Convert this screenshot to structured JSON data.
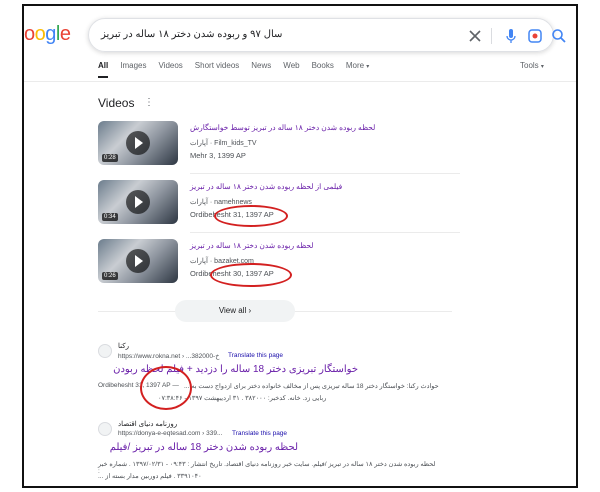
{
  "logo_text": "oogle",
  "search": {
    "query": "سال ۹۷ و ربوده شدن دختر ۱۸ ساله در تبریز"
  },
  "tabs": [
    "All",
    "Images",
    "Videos",
    "Short videos",
    "News",
    "Web",
    "Books",
    "More"
  ],
  "tools_label": "Tools",
  "videos": {
    "heading": "Videos",
    "items": [
      {
        "title": "لحظه ربوده شدن دختر ۱۸ ساله در تبریز توسط خواستگارش",
        "source": "آپارات · Film_kids_TV",
        "date": "Mehr 3, 1399 AP",
        "duration": "0:28"
      },
      {
        "title": "فیلمی از لحظه ربوده شدن دختر ۱۸ ساله در تبریز",
        "source": "آپارات · namehnews",
        "date": "Ordibehesht 31, 1397 AP",
        "duration": "0:34"
      },
      {
        "title": "لحظه ربوده شدن دختر ۱۸ ساله در تبریز",
        "source": "آپارات · bazaket.com",
        "date": "Ordibehesht 30, 1397 AP",
        "duration": "0:26"
      }
    ],
    "view_all": "View all"
  },
  "results": [
    {
      "site": "رکنا",
      "url": "https://www.rokna.net › ...ﺥ-382000",
      "translate": "Translate this page",
      "title": "خواستگار تبریزی دختر 18 ساله را دزدید + فیلم لحظه ربودن",
      "snippet1": "حوادث رکنا: خواستگار دختر 18 ساله تبریزی پس از مخالف خانواده دختر برای ازدواج دست به ...",
      "date": "Ordibehesht 31, 1397 AP —",
      "snippet2": "ربایی زد. خانه. کدخبر: ۳۸۲۰۰۰ . ۳۱ اردیبهشت ۱۳۹۷ - ۰۷:۳۸:۴۶"
    },
    {
      "site": "روزنامه دنیای اقتصاد",
      "url": "https://donya-e-eqtesad.com › 339...",
      "translate": "Translate this page",
      "title": "لحظه ربوده شدن دختر 18 ساله در تبریز /فیلم",
      "snippet1": "لحظه ربوده شدن دختر ۱۸ ساله در تبریز /فیلم. سایت خبر روزنامه دنیای اقتصاد. تاریخ انتشار : ۰۹:۴۳ - ۱۳۹۷/۰۲/۳۱ . شماره خبر :",
      "snippet2": "۳۳۹۱۰۴۰ . فیلم دوربین مدار بسته از ..."
    }
  ],
  "colors": {
    "visited_link": "#681da8",
    "annotation": "#d32020"
  }
}
